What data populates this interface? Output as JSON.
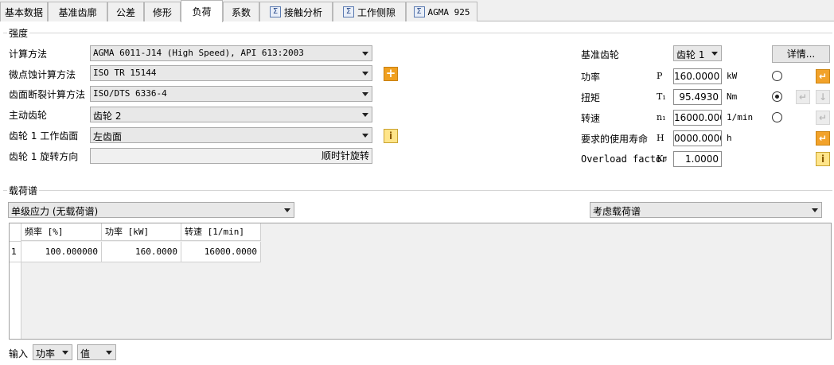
{
  "tabs": [
    {
      "label": "基本数据",
      "icon": ""
    },
    {
      "label": "基准齿廓",
      "icon": ""
    },
    {
      "label": "公差",
      "icon": ""
    },
    {
      "label": "修形",
      "icon": ""
    },
    {
      "label": "负荷",
      "icon": "",
      "active": true
    },
    {
      "label": "系数",
      "icon": ""
    },
    {
      "label": "接触分析",
      "icon": "sigma-icon"
    },
    {
      "label": "工作侧隙",
      "icon": "sigma-icon"
    },
    {
      "label": "AGMA 925",
      "icon": "sigma-icon"
    }
  ],
  "strength": {
    "title": "强度",
    "calc_method_label": "计算方法",
    "calc_method_value": "AGMA 6011-J14 (High Speed), API 613:2003",
    "micropitting_label": "微点蚀计算方法",
    "micropitting_value": "ISO TR 15144",
    "flank_fracture_label": "齿面断裂计算方法",
    "flank_fracture_value": "ISO/DTS 6336-4",
    "driving_gear_label": "主动齿轮",
    "driving_gear_value": "齿轮 2",
    "working_flank_label": "齿轮 1 工作齿面",
    "working_flank_value": "左齿面",
    "rotation_label": "齿轮 1 旋转方向",
    "rotation_value": "顺时针旋转"
  },
  "right_panel": {
    "ref_gear_label": "基准齿轮",
    "ref_gear_value": "齿轮 1",
    "details_button": "详情...",
    "power": {
      "label": "功率",
      "symbol": "P",
      "value": "160.0000",
      "unit": "kW",
      "selected": false
    },
    "torque": {
      "label": "扭矩",
      "symbol": "T₁",
      "value": "95.4930",
      "unit": "Nm",
      "selected": true
    },
    "speed": {
      "label": "转速",
      "symbol": "n₁",
      "value": "16000.0000",
      "unit": "1/min",
      "selected": false
    },
    "life": {
      "label": "要求的使用寿命",
      "symbol": "H",
      "value": "0000.0000",
      "unit": "h"
    },
    "overload": {
      "label": "Overload factor",
      "symbol": "K₀",
      "value": "1.0000"
    }
  },
  "spectrum": {
    "title": "载荷谱",
    "mode_value": "单级应力 (无载荷谱)",
    "consider_value": "考虑载荷谱",
    "columns": [
      "频率 [%]",
      "功率 [kW]",
      "转速 [1/min]"
    ],
    "rows": [
      {
        "index": "1",
        "cells": [
          "100.000000",
          "160.0000",
          "16000.0000"
        ]
      }
    ]
  },
  "input_bar": {
    "label": "输入",
    "mode_value": "功率",
    "type_value": "值"
  },
  "colors": {
    "accent": "#f0a020",
    "border": "#aaaaaa"
  }
}
